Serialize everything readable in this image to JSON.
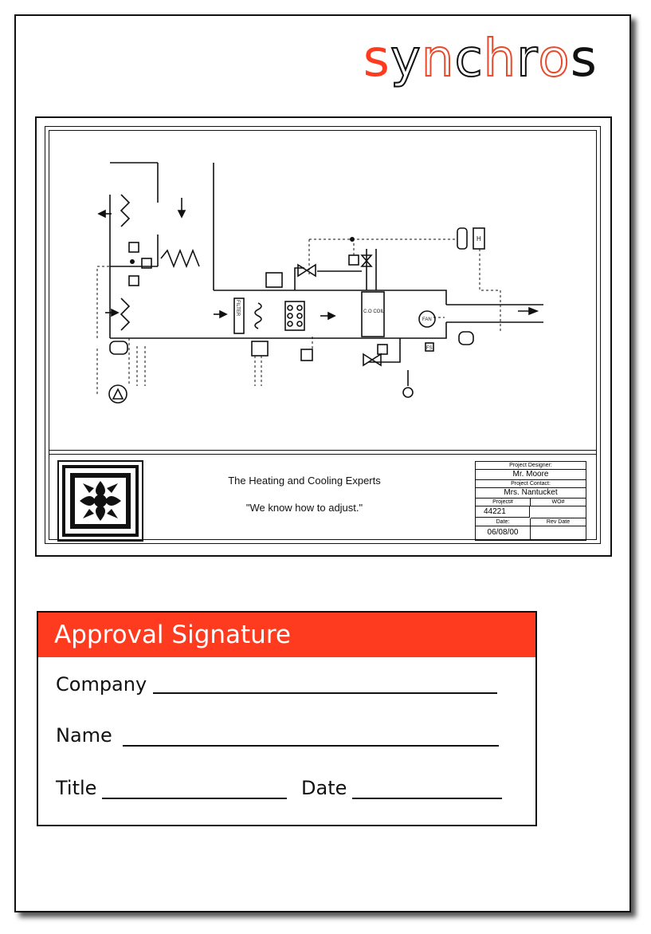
{
  "brand": {
    "letters": [
      "s",
      "y",
      "n",
      "c",
      "h",
      "r",
      "o",
      "s"
    ],
    "accent": "#ff3b1f"
  },
  "drawing": {
    "labels": {
      "filter": "FILTER",
      "coil": "C.O COIL",
      "fan": "FAN",
      "fs": "FS",
      "h": "H"
    },
    "tagline": "The Heating and Cooling Experts",
    "motto": "\"We know how to adjust.\"",
    "project": {
      "designer_label": "Project Designer:",
      "designer": "Mr. Moore",
      "contact_label": "Project Contact:",
      "contact": "Mrs. Nantucket",
      "number_label": "Project#",
      "wo_label": "WO#",
      "number": "44221",
      "date_label": "Date:",
      "rev_label": "Rev Date",
      "date": "06/08/00"
    }
  },
  "approval": {
    "title": "Approval Signature",
    "company": "Company",
    "name": "Name",
    "title_field": "Title",
    "date": "Date"
  }
}
